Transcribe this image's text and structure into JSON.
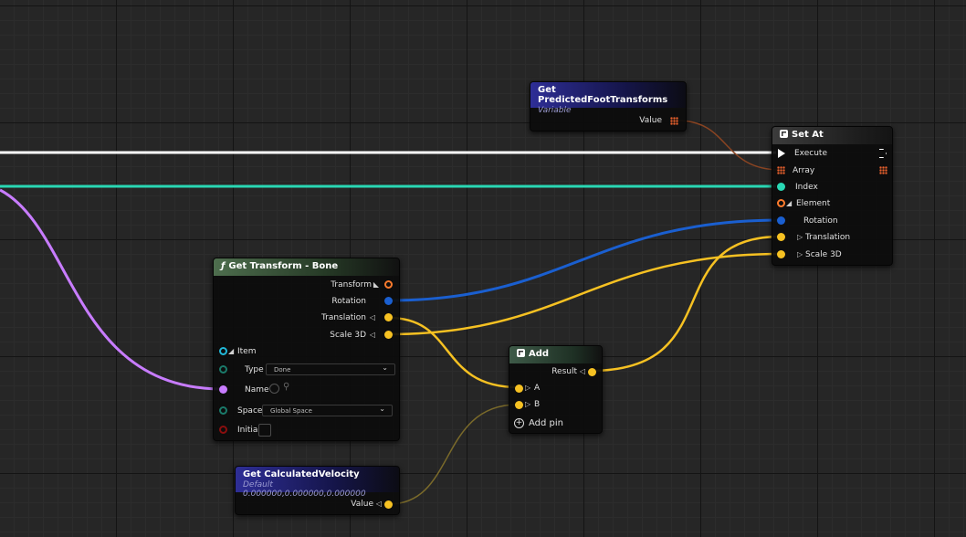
{
  "colors": {
    "exec": "#ffffff",
    "float": "#29d8b4",
    "name": "#c87cff",
    "rotator": "#1a5fd0",
    "vector": "#f6c122",
    "array": "#e8602c",
    "struct_transform": "#ff7b2c",
    "item": "#21b8d8",
    "bool": "#8b0e0e"
  },
  "nodes": {
    "get_predicted": {
      "title": "Get PredictedFootTransforms",
      "subtitle": "Variable",
      "value_label": "Value"
    },
    "set_at": {
      "title": "Set At",
      "icon": "array-function-icon",
      "pins": {
        "execute": "Execute",
        "array": "Array",
        "index": "Index",
        "element": "Element",
        "rotation": "Rotation",
        "translation": "Translation",
        "scale": "Scale 3D"
      }
    },
    "get_transform": {
      "title": "Get Transform - Bone",
      "icon": "function-icon",
      "outputs": {
        "transform": "Transform",
        "rotation": "Rotation",
        "translation": "Translation",
        "scale": "Scale 3D"
      },
      "inputs": {
        "item": "Item",
        "type": "Type",
        "type_value": "Done",
        "name": "Name",
        "space": "Space",
        "space_value": "Global Space",
        "initial": "Initial"
      }
    },
    "add": {
      "title": "Add",
      "result": "Result",
      "a": "A",
      "b": "B",
      "add_pin": "Add pin"
    },
    "get_velocity": {
      "title": "Get CalculatedVelocity",
      "subtitle": "Default 0.000000,0.000000,0.000000",
      "value_label": "Value"
    }
  }
}
